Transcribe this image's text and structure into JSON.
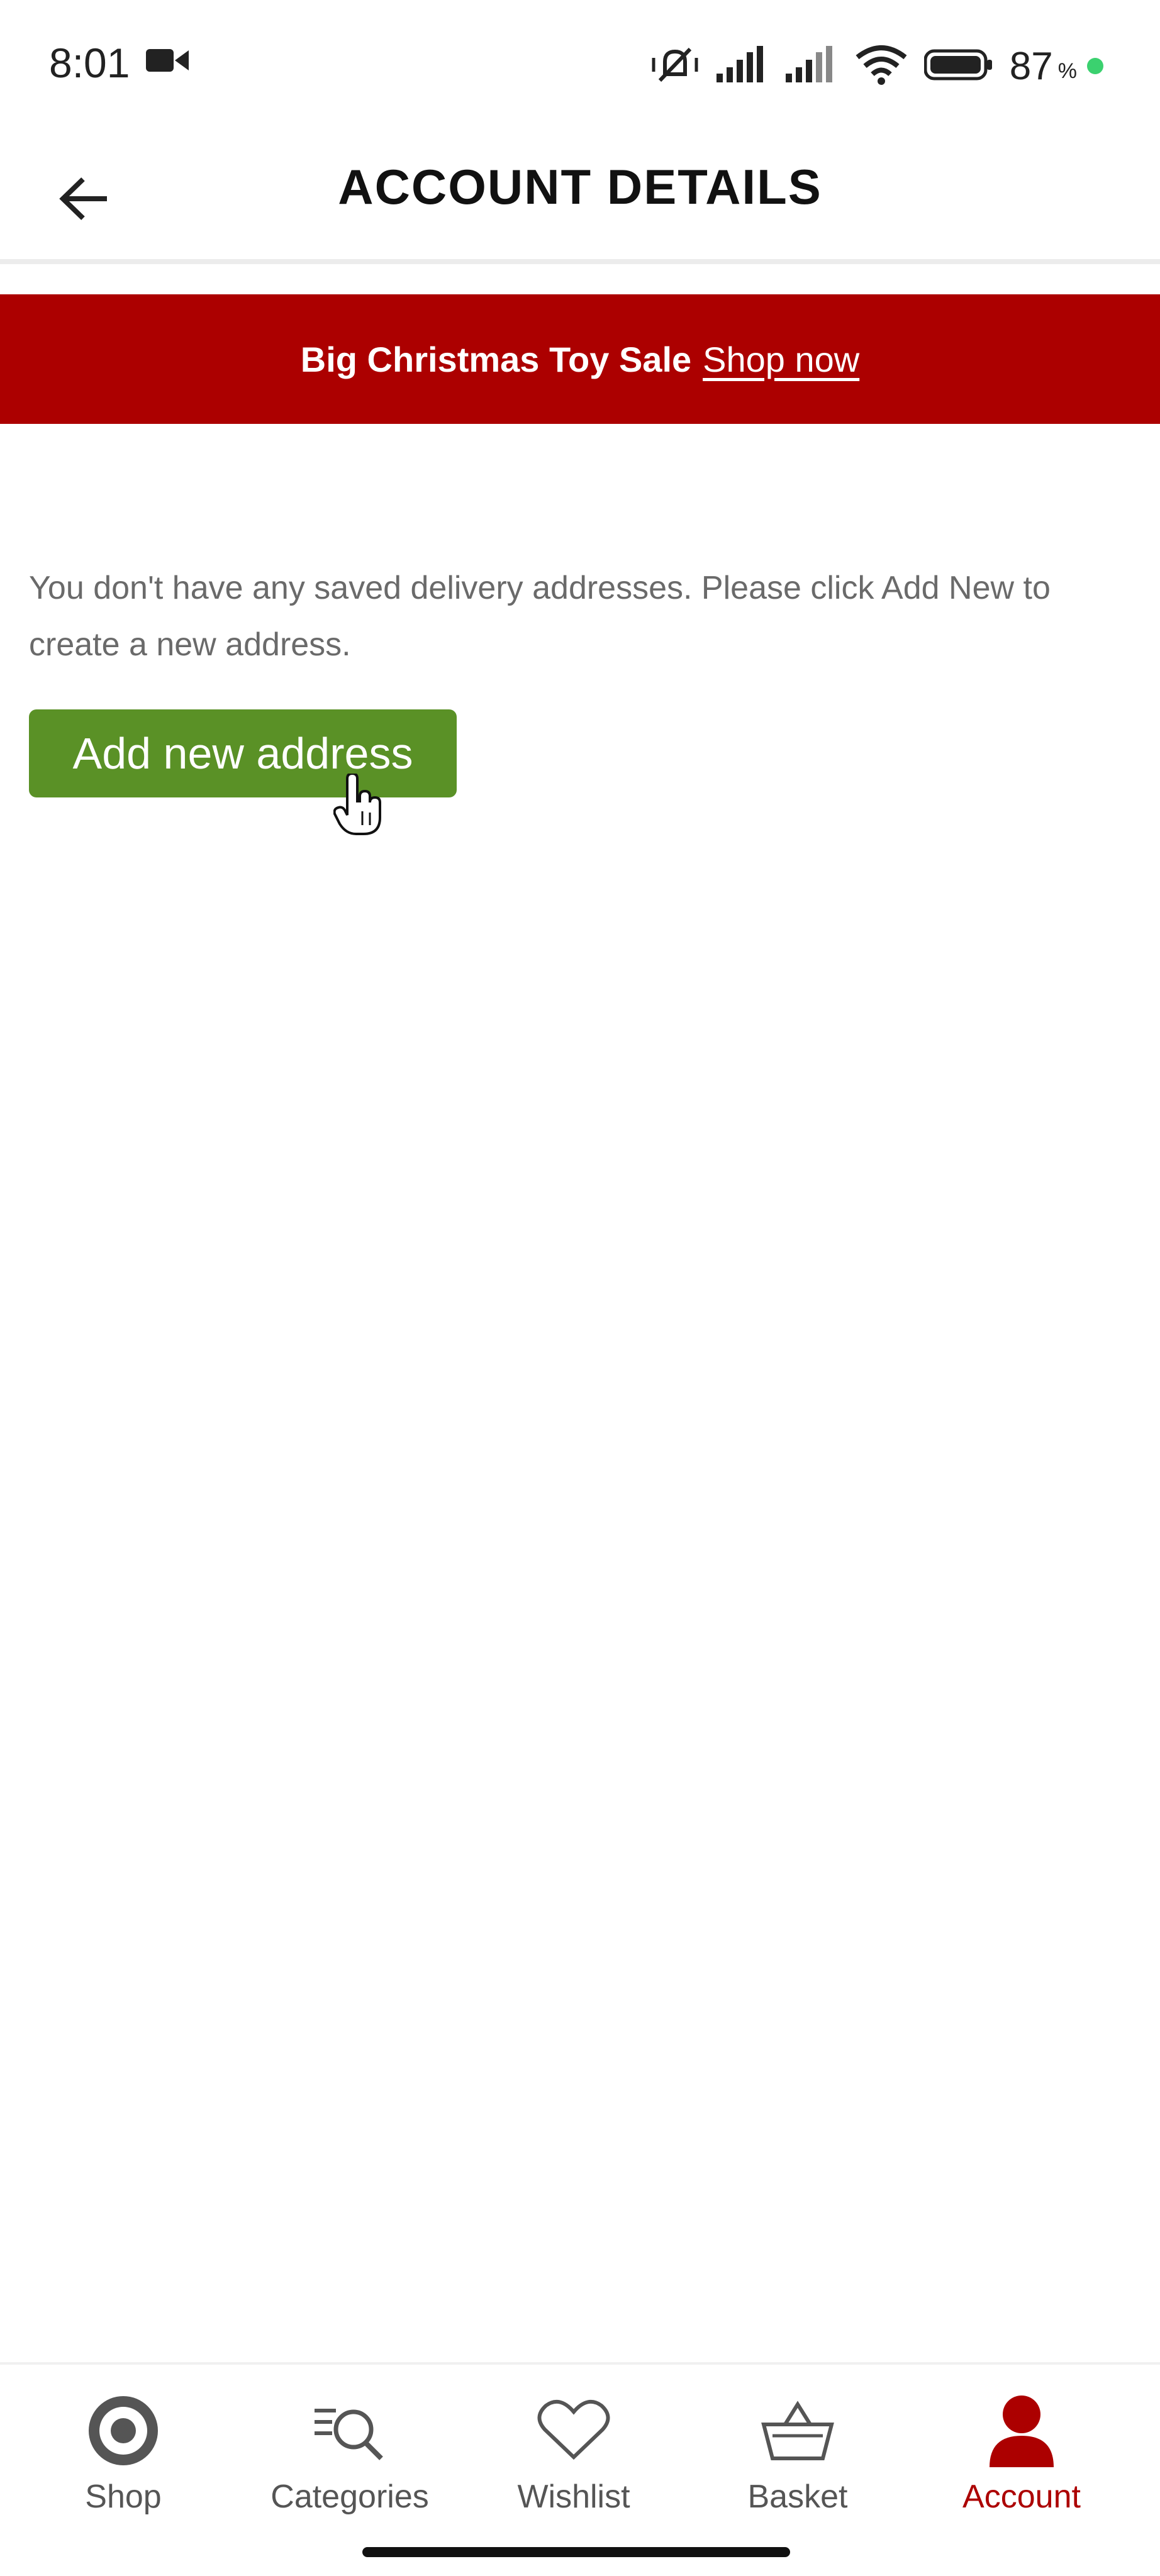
{
  "status_bar": {
    "time": "8:01",
    "battery_percent": "87",
    "battery_symbol": "%",
    "icons": [
      "video-camera-icon",
      "mute-vibrate-icon",
      "signal-icon",
      "signal-icon",
      "wifi-icon",
      "battery-icon"
    ]
  },
  "header": {
    "title": "ACCOUNT DETAILS",
    "back_icon": "arrow-left-icon"
  },
  "promo": {
    "text": "Big Christmas Toy Sale",
    "link": "Shop now",
    "background": "#ac0000"
  },
  "main": {
    "empty_message": "You don't have any saved delivery addresses. Please click Add New to create a new address.",
    "add_button_label": "Add new address",
    "add_button_color": "#5a9126"
  },
  "bottom_nav": {
    "active_color": "#ac0000",
    "items": [
      {
        "label": "Shop",
        "icon": "target-icon"
      },
      {
        "label": "Categories",
        "icon": "list-search-icon"
      },
      {
        "label": "Wishlist",
        "icon": "heart-icon"
      },
      {
        "label": "Basket",
        "icon": "basket-icon"
      },
      {
        "label": "Account",
        "icon": "person-icon",
        "active": true
      }
    ]
  }
}
